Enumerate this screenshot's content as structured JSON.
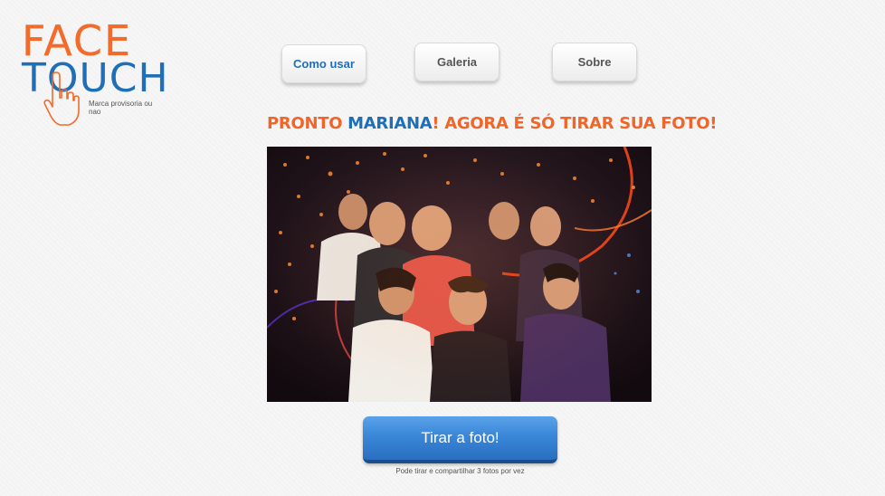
{
  "logo": {
    "line1": "FACE",
    "line2": "TOUCH",
    "tagline": "Marca provisoria ou nao"
  },
  "nav": {
    "como_usar": "Como usar",
    "galeria": "Galeria",
    "sobre": "Sobre"
  },
  "headline": {
    "prefix": "PRONTO ",
    "name": "MARIANA",
    "suffix": "! AGORA É SÓ TIRAR SUA FOTO!"
  },
  "photo": {
    "icon": "party-photo"
  },
  "action": {
    "shoot_label": "Tirar a foto!",
    "hint": "Pode tirar e compartilhar 3 fotos por vez"
  },
  "colors": {
    "brand_orange": "#f0662a",
    "brand_blue": "#1f6fb8",
    "button_blue": "#3a86d8"
  }
}
